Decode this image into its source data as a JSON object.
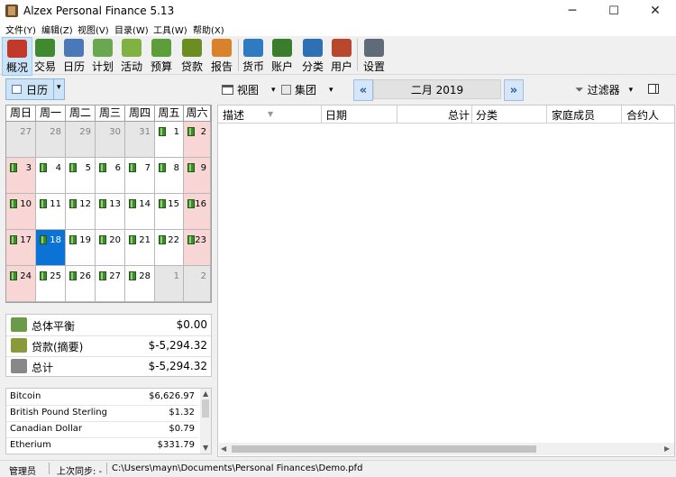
{
  "window": {
    "title": "Alzex Personal Finance 5.13",
    "minimize": "─",
    "maximize": "☐",
    "close": "✕"
  },
  "menu": [
    "文件(Y)",
    "编辑(Z)",
    "视图(V)",
    "目录(W)",
    "工具(W)",
    "帮助(X)"
  ],
  "toolbar": [
    {
      "label": "概况",
      "icon": "overview-icon",
      "color": "#c0392b"
    },
    {
      "label": "交易",
      "icon": "transactions-book-icon",
      "color": "#3f8a2e"
    },
    {
      "label": "日历",
      "icon": "calendar-icon",
      "color": "#4a78b8"
    },
    {
      "label": "计划",
      "icon": "plan-clock-icon",
      "color": "#6aa84f"
    },
    {
      "label": "活动",
      "icon": "activity-check-icon",
      "color": "#7fb241"
    },
    {
      "label": "预算",
      "icon": "budget-money-icon",
      "color": "#5c9e3a"
    },
    {
      "label": "贷款",
      "icon": "loan-money-icon",
      "color": "#6b8e23"
    },
    {
      "label": "报告",
      "icon": "report-chart-icon",
      "color": "#d9822b"
    },
    {
      "label": "货币",
      "icon": "currency-exchange-icon",
      "color": "#2e7bc4"
    },
    {
      "label": "账户",
      "icon": "account-wallet-icon",
      "color": "#3a7d2c"
    },
    {
      "label": "分类",
      "icon": "category-tree-icon",
      "color": "#2f6fb5"
    },
    {
      "label": "用户",
      "icon": "users-icon",
      "color": "#b8472e"
    },
    {
      "label": "设置",
      "icon": "settings-cabinet-icon",
      "color": "#5f6b78"
    }
  ],
  "subbar": {
    "calendar_btn": "日历",
    "view_btn": "视图",
    "group_btn": "集团",
    "month": "二月 2019",
    "filter_btn": "过滤器"
  },
  "calendar": {
    "weekdays": [
      "周日",
      "周一",
      "周二",
      "周三",
      "周四",
      "周五",
      "周六"
    ],
    "weeks": [
      [
        {
          "d": "27",
          "t": "other"
        },
        {
          "d": "28",
          "t": "other"
        },
        {
          "d": "29",
          "t": "other"
        },
        {
          "d": "30",
          "t": "other"
        },
        {
          "d": "31",
          "t": "other"
        },
        {
          "d": "1",
          "t": "day",
          "b": true
        },
        {
          "d": "2",
          "t": "wknd",
          "b": true
        }
      ],
      [
        {
          "d": "3",
          "t": "wknd",
          "b": true
        },
        {
          "d": "4",
          "t": "day",
          "b": true
        },
        {
          "d": "5",
          "t": "day",
          "b": true
        },
        {
          "d": "6",
          "t": "day",
          "b": true
        },
        {
          "d": "7",
          "t": "day",
          "b": true
        },
        {
          "d": "8",
          "t": "day",
          "b": true
        },
        {
          "d": "9",
          "t": "wknd",
          "b": true
        }
      ],
      [
        {
          "d": "10",
          "t": "wknd",
          "b": true
        },
        {
          "d": "11",
          "t": "day",
          "b": true
        },
        {
          "d": "12",
          "t": "day",
          "b": true
        },
        {
          "d": "13",
          "t": "day",
          "b": true
        },
        {
          "d": "14",
          "t": "day",
          "b": true
        },
        {
          "d": "15",
          "t": "day",
          "b": true
        },
        {
          "d": "16",
          "t": "wknd",
          "b": true
        }
      ],
      [
        {
          "d": "17",
          "t": "wknd",
          "b": true
        },
        {
          "d": "18",
          "t": "today",
          "b": true
        },
        {
          "d": "19",
          "t": "day",
          "b": true
        },
        {
          "d": "20",
          "t": "day",
          "b": true
        },
        {
          "d": "21",
          "t": "day",
          "b": true
        },
        {
          "d": "22",
          "t": "day",
          "b": true
        },
        {
          "d": "23",
          "t": "wknd",
          "b": true
        }
      ],
      [
        {
          "d": "24",
          "t": "wknd",
          "b": true
        },
        {
          "d": "25",
          "t": "day",
          "b": true
        },
        {
          "d": "26",
          "t": "day",
          "b": true
        },
        {
          "d": "27",
          "t": "day",
          "b": true
        },
        {
          "d": "28",
          "t": "day",
          "b": true
        },
        {
          "d": "1",
          "t": "other"
        },
        {
          "d": "2",
          "t": "other"
        }
      ]
    ]
  },
  "summary": [
    {
      "label": "总体平衡",
      "value": "$0.00",
      "icon": "balance-money-icon"
    },
    {
      "label": "贷款(摘要)",
      "value": "$-5,294.32",
      "icon": "loan-summary-icon"
    },
    {
      "label": "总计",
      "value": "$-5,294.32",
      "icon": "scales-icon"
    }
  ],
  "currencies": [
    {
      "name": "Bitcoin",
      "value": "$6,626.97"
    },
    {
      "name": "British Pound Sterling",
      "value": "$1.32"
    },
    {
      "name": "Canadian Dollar",
      "value": "$0.79"
    },
    {
      "name": "Etherium",
      "value": "$331.79"
    }
  ],
  "grid": {
    "columns": [
      "描述",
      "日期",
      "总计",
      "分类",
      "家庭成员",
      "合约人"
    ]
  },
  "status": {
    "user": "管理员",
    "sync": "上次同步: -",
    "path": "C:\\Users\\mayn\\Documents\\Personal Finances\\Demo.pfd"
  }
}
